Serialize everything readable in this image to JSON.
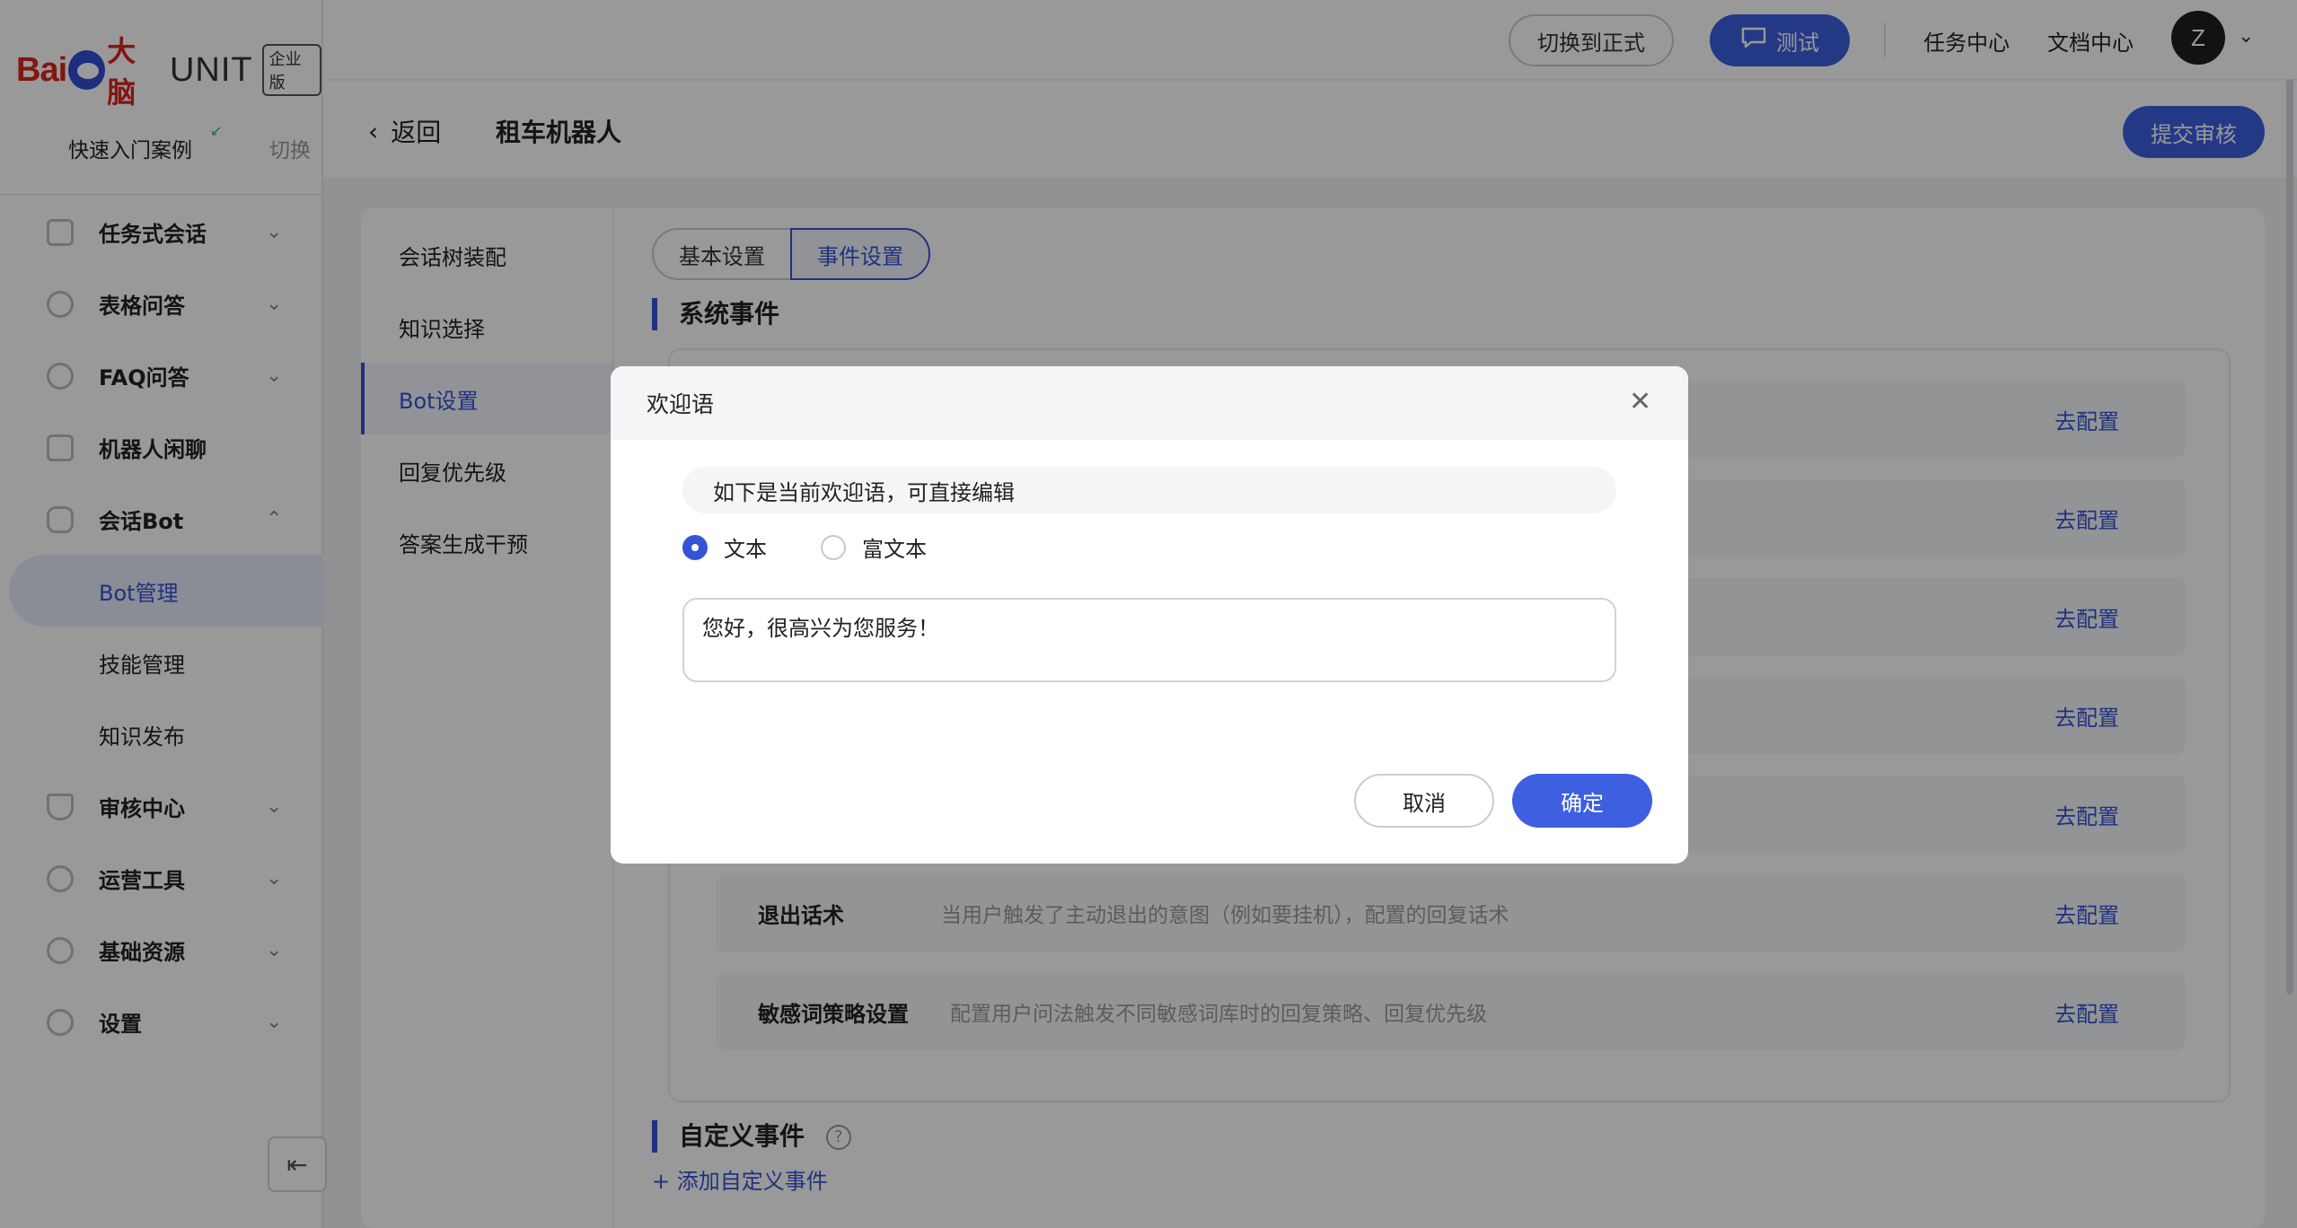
{
  "brand": {
    "bai": "Bai",
    "du": "du",
    "danao": "大脑",
    "unit": "UNIT",
    "edition": "企业版"
  },
  "quick": {
    "title": "快速入门案例",
    "switch": "切换"
  },
  "sidebar": {
    "items": [
      {
        "label": "任务式会话",
        "chevron": "⌄"
      },
      {
        "label": "表格问答",
        "chevron": "⌄"
      },
      {
        "label": "FAQ问答",
        "chevron": "⌄"
      },
      {
        "label": "机器人闲聊",
        "chevron": ""
      },
      {
        "label": "会话Bot",
        "chevron": "⌃"
      }
    ],
    "sub_items": [
      {
        "label": "Bot管理",
        "active": true
      },
      {
        "label": "技能管理"
      },
      {
        "label": "知识发布"
      }
    ],
    "items_after": [
      {
        "label": "审核中心",
        "chevron": "⌄"
      },
      {
        "label": "运营工具",
        "chevron": "⌄"
      },
      {
        "label": "基础资源",
        "chevron": "⌄"
      },
      {
        "label": "设置",
        "chevron": "⌄"
      }
    ],
    "collapse_icon": "⇤"
  },
  "topbar": {
    "switch_label": "切换到正式",
    "test_label": "测试",
    "task_center": "任务中心",
    "doc_center": "文档中心",
    "avatar": "Z"
  },
  "subheader": {
    "back": "返回",
    "robot_name": "租车机器人",
    "submit": "提交审核"
  },
  "inner_nav": [
    "会话树装配",
    "知识选择",
    "Bot设置",
    "回复优先级",
    "答案生成干预"
  ],
  "tabs": [
    "基本设置",
    "事件设置"
  ],
  "system_events_title": "系统事件",
  "event_link_label": "去配置",
  "events": [
    {
      "name": "",
      "desc": ""
    },
    {
      "name": "",
      "desc": ""
    },
    {
      "name": "",
      "desc": ""
    },
    {
      "name": "",
      "desc": ""
    },
    {
      "name": "",
      "desc": ""
    },
    {
      "name": "退出话术",
      "desc": "当用户触发了主动退出的意图（例如要挂机），配置的回复话术"
    },
    {
      "name": "敏感词策略设置",
      "desc": "配置用户问法触发不同敏感词库时的回复策略、回复优先级"
    }
  ],
  "custom_events_title": "自定义事件",
  "add_custom_event": "添加自定义事件",
  "modal": {
    "title": "欢迎语",
    "tip": "如下是当前欢迎语，可直接编辑",
    "radio_text": "文本",
    "radio_rich": "富文本",
    "selected": "文本",
    "greeting_value": "您好，很高兴为您服务！",
    "cancel": "取消",
    "confirm": "确定"
  },
  "colors": {
    "accent": "#3d5fe0",
    "brand_red": "#d9261c",
    "overlay": "rgba(0,0,0,0.40)"
  }
}
